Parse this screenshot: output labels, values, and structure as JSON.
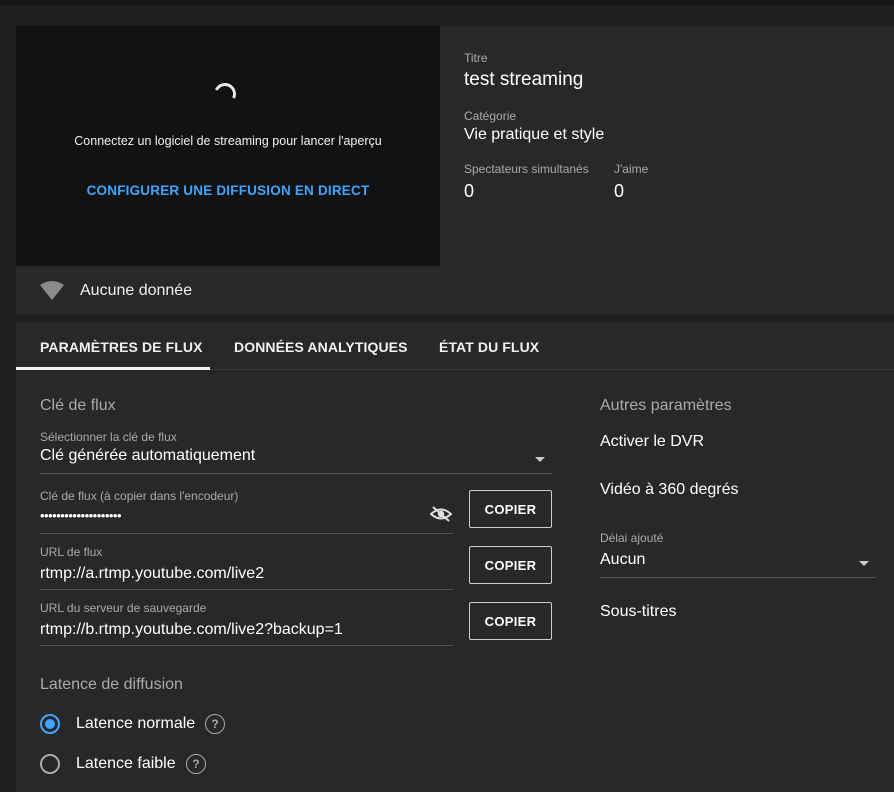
{
  "preview": {
    "message": "Connectez un logiciel de streaming pour lancer l'aperçu",
    "configure_link": "CONFIGURER UNE DIFFUSION EN DIRECT"
  },
  "info": {
    "title_label": "Titre",
    "title_value": "test streaming",
    "category_label": "Catégorie",
    "category_value": "Vie pratique et style",
    "viewers_label": "Spectateurs simultanés",
    "viewers_value": "0",
    "likes_label": "J'aime",
    "likes_value": "0"
  },
  "status": {
    "text": "Aucune donnée",
    "icon": "wifi-signal-icon"
  },
  "tabs": [
    {
      "label": "PARAMÈTRES DE FLUX",
      "active": true
    },
    {
      "label": "DONNÉES ANALYTIQUES",
      "active": false
    },
    {
      "label": "ÉTAT DU FLUX",
      "active": false
    }
  ],
  "stream_key": {
    "section_title": "Clé de flux",
    "select_label": "Sélectionner la clé de flux",
    "select_value": "Clé générée automatiquement",
    "key_label": "Clé de flux (à copier dans l'encodeur)",
    "key_value": "••••••••••••••••••••",
    "url_label": "URL de flux",
    "url_value": "rtmp://a.rtmp.youtube.com/live2",
    "backup_label": "URL du serveur de sauvegarde",
    "backup_value": "rtmp://b.rtmp.youtube.com/live2?backup=1",
    "copy_label": "COPIER"
  },
  "latency": {
    "section_title": "Latence de diffusion",
    "options": [
      {
        "label": "Latence normale",
        "selected": true
      },
      {
        "label": "Latence faible",
        "selected": false
      }
    ]
  },
  "other_settings": {
    "section_title": "Autres paramètres",
    "dvr_label": "Activer le DVR",
    "video360_label": "Vidéo à 360 degrés",
    "delay_label": "Délai ajouté",
    "delay_value": "Aucun",
    "subtitles_label": "Sous-titres"
  },
  "colors": {
    "accent": "#3ea6ff",
    "background": "#1f1f1f",
    "surface": "#282828"
  }
}
